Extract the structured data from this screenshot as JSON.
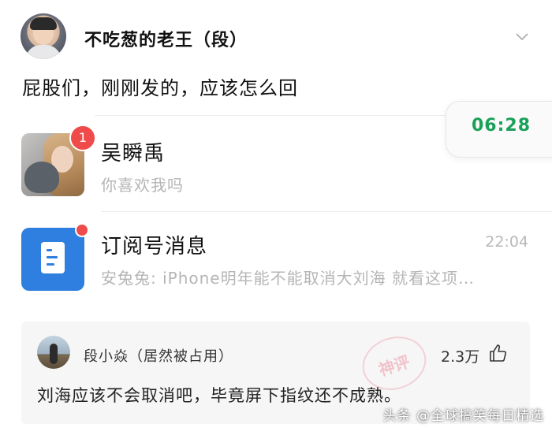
{
  "post": {
    "author_name": "不吃葱的老王（段）",
    "text": "屁股们，刚刚发的，应该怎么回"
  },
  "screenshot": {
    "popup_time": "06:28",
    "chats": [
      {
        "name": "吴瞬禹",
        "preview": "你喜欢我吗",
        "unread": "1",
        "time": ""
      },
      {
        "name": "订阅号消息",
        "preview": "安兔兔: iPhone明年能不能取消大刘海 就看这项…",
        "time": "22:04"
      }
    ]
  },
  "comment": {
    "author": "段小焱（居然被占用）",
    "likes": "2.3万",
    "text": "刘海应该不会取消吧，毕竟屏下指纹还不成熟。",
    "stamp_text": "神评"
  },
  "watermark": "头条 @全球搞笑每日精选",
  "colors": {
    "time_green": "#1aa05a",
    "badge_red": "#ef4b4b",
    "subscription_blue": "#2f7fe0"
  }
}
